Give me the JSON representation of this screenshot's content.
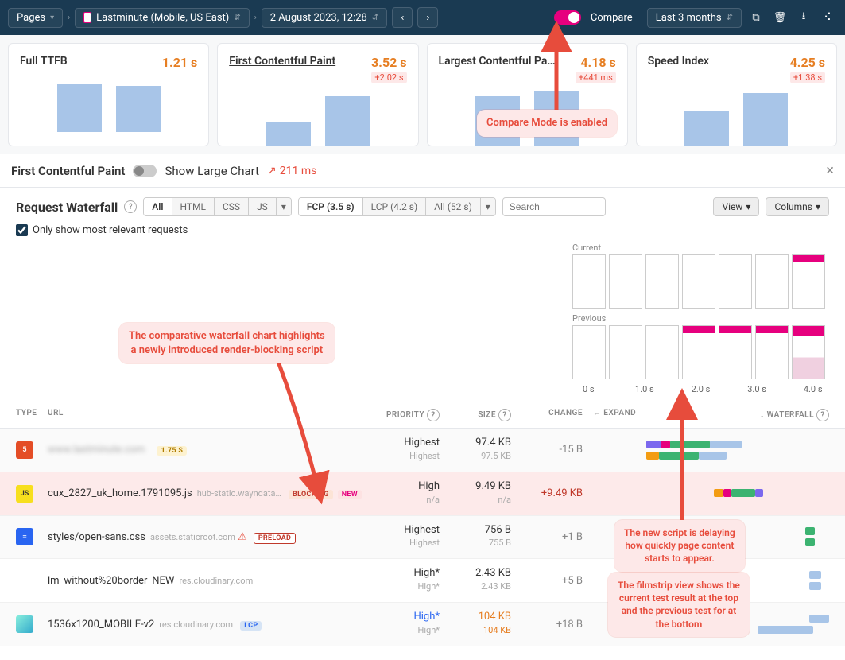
{
  "topbar": {
    "pages": "Pages",
    "site": "Lastminute (Mobile, US East)",
    "date": "2 August 2023, 12:28",
    "compare": "Compare",
    "range": "Last 3 months"
  },
  "cards": [
    {
      "title": "Full TTFB",
      "value": "1.21 s",
      "delta": "",
      "bars": [
        60,
        58
      ]
    },
    {
      "title": "First Contentful Paint",
      "value": "3.52 s",
      "delta": "+2.02 s",
      "bars": [
        30,
        62
      ],
      "underline": true
    },
    {
      "title": "Largest Contentful Pa…",
      "value": "4.18 s",
      "delta": "+441 ms",
      "bars": [
        62,
        68
      ]
    },
    {
      "title": "Speed Index",
      "value": "4.25 s",
      "delta": "+1.38 s",
      "bars": [
        44,
        66
      ]
    }
  ],
  "section": {
    "title": "First Contentful Paint",
    "large_chart": "Show Large Chart",
    "trend": "211 ms"
  },
  "waterfall": {
    "title": "Request Waterfall",
    "filters_type": [
      "All",
      "HTML",
      "CSS",
      "JS"
    ],
    "filters_phase": [
      "FCP (3.5 s)",
      "LCP (4.2 s)",
      "All (52 s)"
    ],
    "search_placeholder": "Search",
    "view": "View",
    "columns": "Columns",
    "only_relevant": "Only show most relevant requests"
  },
  "filmstrip": {
    "current": "Current",
    "previous": "Previous",
    "times": [
      "0 s",
      "1.0 s",
      "2.0 s",
      "3.0 s",
      "4.0 s"
    ]
  },
  "table": {
    "headers": {
      "type": "TYPE",
      "url": "URL",
      "priority": "PRIORITY",
      "size": "SIZE",
      "change": "CHANGE",
      "expand": "← EXPAND",
      "waterfall": "↓ WATERFALL"
    },
    "rows": [
      {
        "icon": "html",
        "url": "www.lastminute.com",
        "blur": true,
        "sub": "",
        "badges": [
          {
            "t": "1.75 S",
            "c": "time"
          }
        ],
        "priority": "Highest",
        "priority2": "Highest",
        "size": "97.4 KB",
        "size2": "97.5 KB",
        "change": "-15 B",
        "change_color": "neutral"
      },
      {
        "icon": "js",
        "url": "cux_2827_uk_home.1791095.js",
        "sub": "hub-static.wayndata…",
        "badges": [
          {
            "t": "BLOCKING",
            "c": "blocking"
          },
          {
            "t": "NEW",
            "c": "new"
          }
        ],
        "priority": "High",
        "priority2": "n/a",
        "size": "9.49 KB",
        "size2": "n/a",
        "change": "+9.49 KB",
        "change_color": "pos",
        "hl": true
      },
      {
        "icon": "css",
        "url": "styles/open-sans.css",
        "sub": "assets.staticroot.com",
        "badges": [
          {
            "t": "PRELOAD",
            "c": "preload",
            "warn": true
          }
        ],
        "priority": "Highest",
        "priority2": "Highest",
        "size": "756 B",
        "size2": "755 B",
        "change": "+1 B",
        "change_color": "neutral"
      },
      {
        "icon": "",
        "url": "lm_without%20border_NEW",
        "sub": "res.cloudinary.com",
        "badges": [],
        "priority": "High*",
        "priority2": "High*",
        "size": "2.43 KB",
        "size2": "2.43 KB",
        "change": "+5 B",
        "change_color": "neutral"
      },
      {
        "icon": "img",
        "url": "1536x1200_MOBILE-v2",
        "sub": "res.cloudinary.com",
        "badges": [
          {
            "t": "LCP",
            "c": "lcp"
          }
        ],
        "priority": "High*",
        "priority2": "High*",
        "priority_blue": true,
        "size": "104 KB",
        "size2": "104 KB",
        "size_orange": true,
        "change": "+18 B",
        "change_color": "neutral"
      }
    ]
  },
  "callouts": {
    "compare": "Compare Mode  is enabled",
    "waterfall_note_1": "The comparative waterfall chart highlights",
    "waterfall_note_2": "a newly introduced render-blocking script",
    "delay_1": "The new script is delaying",
    "delay_2": "how quickly page content",
    "delay_3": "starts to appear.",
    "filmstrip_1": "The filmstrip view shows the",
    "filmstrip_2": "current test result at the top",
    "filmstrip_3": "and the previous test for at",
    "filmstrip_4": "the bottom"
  }
}
